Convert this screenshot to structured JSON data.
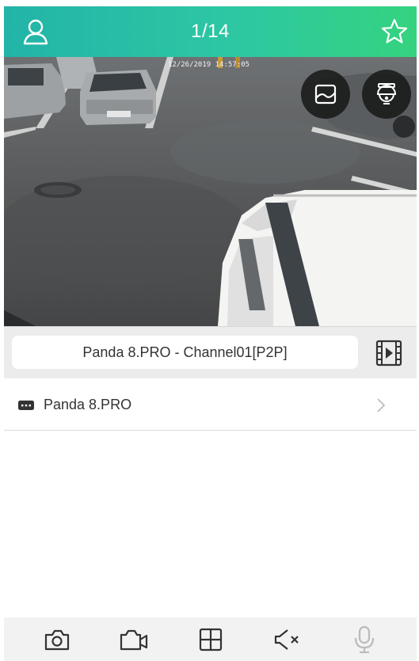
{
  "header": {
    "title": "1/14",
    "left_icon": "user-icon",
    "right_icon": "star-icon",
    "gradient": [
      "#22b4a8",
      "#34d37f"
    ]
  },
  "video": {
    "timestamp": "12/26/2019 14:57:05",
    "overlay_buttons": [
      "image-adjust-icon",
      "ptz-dome-camera-icon"
    ]
  },
  "channel_bar": {
    "channel_label": "Panda 8.PRO - Channel01[P2P]",
    "playback_icon": "playback-film-icon"
  },
  "devices": [
    {
      "name": "Panda 8.PRO",
      "icon": "device-icon"
    }
  ],
  "toolbar": {
    "items": [
      "snapshot-camera-icon",
      "record-video-icon",
      "split-screen-icon",
      "mute-speaker-icon",
      "microphone-icon"
    ]
  },
  "colors": {
    "icon_dark": "#333333",
    "icon_disabled": "#bbbbbb",
    "accent": "#2dc7a3"
  }
}
